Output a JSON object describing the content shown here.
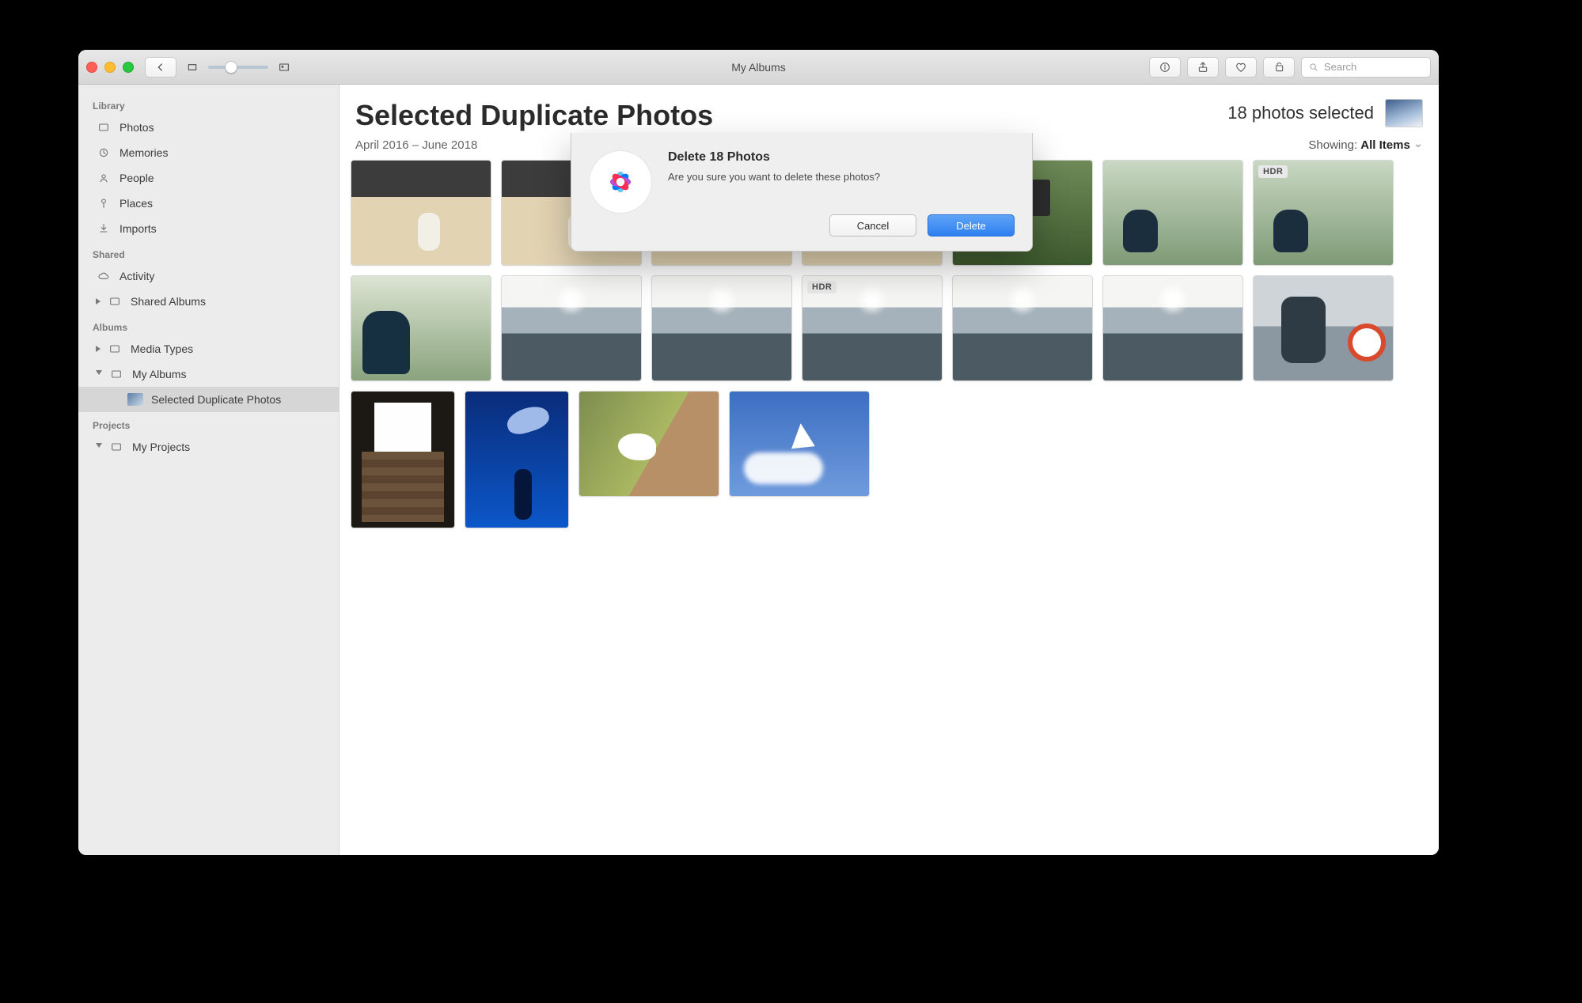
{
  "titlebar": {
    "title": "My Albums",
    "search_placeholder": "Search"
  },
  "sidebar": {
    "sections": {
      "library": {
        "heading": "Library",
        "items": [
          "Photos",
          "Memories",
          "People",
          "Places",
          "Imports"
        ]
      },
      "shared": {
        "heading": "Shared",
        "items": [
          "Activity",
          "Shared Albums"
        ]
      },
      "albums": {
        "heading": "Albums",
        "items": [
          "Media Types",
          "My Albums",
          "Selected Duplicate Photos"
        ]
      },
      "projects": {
        "heading": "Projects",
        "items": [
          "My Projects"
        ]
      }
    }
  },
  "header": {
    "page_title": "Selected Duplicate Photos",
    "date_range": "April 2016 – June 2018",
    "selection_count": "18 photos selected",
    "showing_label": "Showing:",
    "showing_value": "All Items"
  },
  "dialog": {
    "title": "Delete 18 Photos",
    "message": "Are you sure you want to delete these photos?",
    "cancel": "Cancel",
    "confirm": "Delete"
  },
  "toolbar_icons": {
    "info": "info-icon",
    "share": "share-icon",
    "heart": "heart-icon",
    "rotate": "rotate-icon"
  },
  "grid": {
    "row1_badges": [
      null,
      null,
      null,
      null,
      null,
      null,
      "HDR"
    ],
    "row2_badges": [
      null,
      null,
      null,
      "HDR",
      null,
      null,
      null
    ]
  }
}
